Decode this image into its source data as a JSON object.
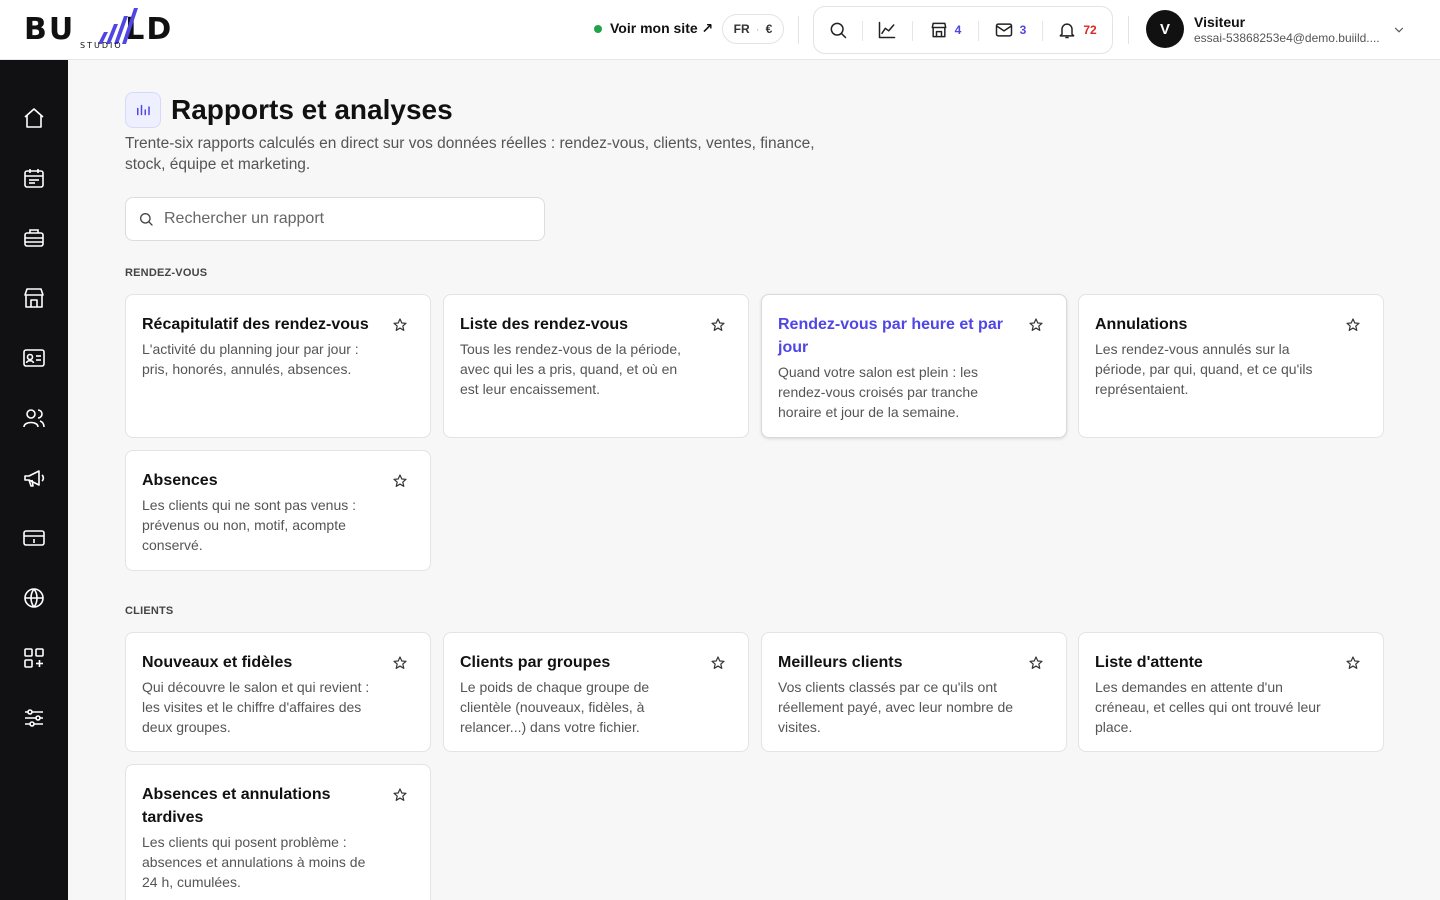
{
  "brand": {
    "name_left": "BU",
    "name_right": "LD",
    "sub": "STUDIO",
    "accent": "#4f46e5"
  },
  "header": {
    "site_link": "Voir mon site ↗",
    "lang": "FR",
    "currency": "€",
    "tools": [
      {
        "icon": "search-icon"
      },
      {
        "icon": "chart-icon"
      },
      {
        "icon": "store-icon",
        "count": "4"
      },
      {
        "icon": "mail-icon",
        "count": "3"
      },
      {
        "icon": "bell-icon",
        "count": "72"
      }
    ],
    "user": {
      "initial": "V",
      "name": "Visiteur",
      "email": "essai-53868253e4@demo.buiild...."
    }
  },
  "sidebar": {
    "items": [
      "home-icon",
      "calendar-icon",
      "services-icon",
      "shop-icon",
      "contact-card-icon",
      "team-icon",
      "megaphone-icon",
      "payment-icon",
      "globe-icon",
      "apps-icon",
      "settings-icon"
    ]
  },
  "page": {
    "title": "Rapports et analyses",
    "subtitle": "Trente-six rapports calculés en direct sur vos données réelles : rendez-vous, clients, ventes, finance, stock, équipe et marketing.",
    "search_placeholder": "Rechercher un rapport"
  },
  "sections": [
    {
      "label": "RENDEZ-VOUS",
      "cards": [
        {
          "title": "Récapitulatif des rendez-vous",
          "desc": "L'activité du planning jour par jour : pris, honorés, annulés, absences."
        },
        {
          "title": "Liste des rendez-vous",
          "desc": "Tous les rendez-vous de la période, avec qui les a pris, quand, et où en est leur encaissement."
        },
        {
          "title": "Rendez-vous par heure et par jour",
          "desc": "Quand votre salon est plein : les rendez-vous croisés par tranche horaire et jour de la semaine."
        },
        {
          "title": "Annulations",
          "desc": "Les rendez-vous annulés sur la période, par qui, quand, et ce qu'ils représentaient."
        },
        {
          "title": "Absences",
          "desc": "Les clients qui ne sont pas venus : prévenus ou non, motif, acompte conservé."
        }
      ]
    },
    {
      "label": "CLIENTS",
      "cards": [
        {
          "title": "Nouveaux et fidèles",
          "desc": "Qui découvre le salon et qui revient : les visites et le chiffre d'affaires des deux groupes."
        },
        {
          "title": "Clients par groupes",
          "desc": "Le poids de chaque groupe de clientèle (nouveaux, fidèles, à relancer...) dans votre fichier."
        },
        {
          "title": "Meilleurs clients",
          "desc": "Vos clients classés par ce qu'ils ont réellement payé, avec leur nombre de visites."
        },
        {
          "title": "Liste d'attente",
          "desc": "Les demandes en attente d'un créneau, et celles qui ont trouvé leur place."
        },
        {
          "title": "Absences et annulations tardives",
          "desc": "Les clients qui posent problème : absences et annulations à moins de 24 h, cumulées."
        }
      ]
    }
  ]
}
